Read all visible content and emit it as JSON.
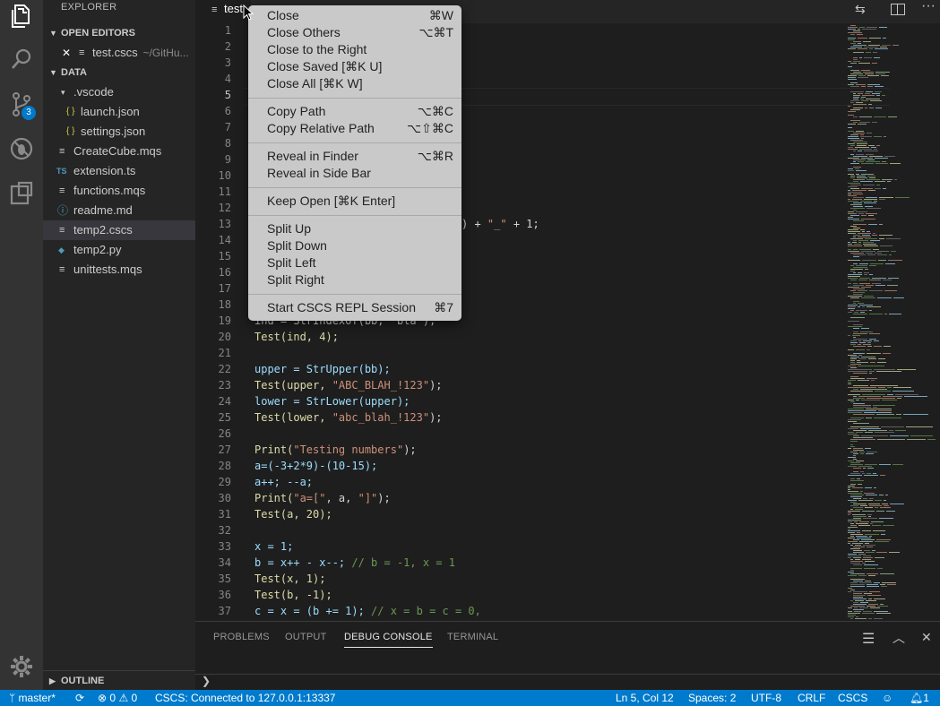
{
  "activity_bar": {
    "badge_count": "3"
  },
  "sidebar": {
    "title": "EXPLORER",
    "open_editors": {
      "header": "OPEN EDITORS",
      "item_name": "test.cscs",
      "item_path": "~/GitHu..."
    },
    "folder": {
      "header": "DATA",
      "items": [
        {
          "name": ".vscode",
          "icon": "▾",
          "level": 1
        },
        {
          "name": "launch.json",
          "icon": "{ }",
          "level": 2
        },
        {
          "name": "settings.json",
          "icon": "{ }",
          "level": 2
        },
        {
          "name": "CreateCube.mqs",
          "icon": "≡",
          "level": 1
        },
        {
          "name": "extension.ts",
          "icon": "TS",
          "level": 1
        },
        {
          "name": "functions.mqs",
          "icon": "≡",
          "level": 1
        },
        {
          "name": "readme.md",
          "icon": "ⓘ",
          "level": 1
        },
        {
          "name": "temp2.cscs",
          "icon": "≡",
          "level": 1
        },
        {
          "name": "temp2.py",
          "icon": "◆",
          "level": 1
        },
        {
          "name": "unittests.mqs",
          "icon": "≡",
          "level": 1
        }
      ]
    },
    "outline": "OUTLINE"
  },
  "editor": {
    "tab_label": "test",
    "line_numbers": [
      "1",
      "2",
      "3",
      "4",
      "5",
      "6",
      "7",
      "8",
      "9",
      "10",
      "11",
      "12",
      "13",
      "14",
      "15",
      "16",
      "17",
      "18",
      "19",
      "20",
      "21",
      "22",
      "23",
      "24",
      "25",
      "26",
      "27",
      "28",
      "29",
      "30",
      "31",
      "32",
      "33",
      "34",
      "35",
      "36",
      "37"
    ],
    "current_line": "5",
    "visible_code": {
      "l13_tail_paren": ") + ",
      "l13_str": "\"_\"",
      "l13_end": " + 1;",
      "l19": "ind = StrIndexOf(bb, \"bla\");",
      "l20": "Test(ind, 4);",
      "l22": "upper = StrUpper(bb);",
      "l23a": "Test(upper, ",
      "l23s": "\"ABC_BLAH_!123\"",
      "l23b": ");",
      "l24": "lower = StrLower(upper);",
      "l25a": "Test(lower, ",
      "l25s": "\"abc_blah_!123\"",
      "l25b": ");",
      "l27a": "Print(",
      "l27s": "\"Testing numbers\"",
      "l27b": ");",
      "l28": "a=(-3+2*9)-(10-15);",
      "l29": "a++; --a;",
      "l30a": "Print(",
      "l30s1": "\"a=[\"",
      "l30m": ", a, ",
      "l30s2": "\"]\"",
      "l30b": ");",
      "l31": "Test(a, 20);",
      "l33": "x = 1;",
      "l34a": "b = x++ - x--; ",
      "l34c": "// b = -1, x = 1",
      "l35": "Test(x, 1);",
      "l36": "Test(b, -1);",
      "l37a": "c = x = (b += 1); ",
      "l37c": "// x = b = c = 0,"
    }
  },
  "context_menu": {
    "items": [
      {
        "label": "Close",
        "shortcut": "⌘W"
      },
      {
        "label": "Close Others",
        "shortcut": "⌥⌘T"
      },
      {
        "label": "Close to the Right",
        "shortcut": ""
      },
      {
        "label": "Close Saved [⌘K U]",
        "shortcut": ""
      },
      {
        "label": "Close All [⌘K W]",
        "shortcut": ""
      },
      {
        "label": "Copy Path",
        "shortcut": "⌥⌘C"
      },
      {
        "label": "Copy Relative Path",
        "shortcut": "⌥⇧⌘C"
      },
      {
        "label": "Reveal in Finder",
        "shortcut": "⌥⌘R"
      },
      {
        "label": "Reveal in Side Bar",
        "shortcut": ""
      },
      {
        "label": "Keep Open [⌘K Enter]",
        "shortcut": ""
      },
      {
        "label": "Split Up",
        "shortcut": ""
      },
      {
        "label": "Split Down",
        "shortcut": ""
      },
      {
        "label": "Split Left",
        "shortcut": ""
      },
      {
        "label": "Split Right",
        "shortcut": ""
      },
      {
        "label": "Start CSCS REPL Session",
        "shortcut": "⌘7"
      }
    ]
  },
  "panel": {
    "tabs": [
      "PROBLEMS",
      "OUTPUT",
      "DEBUG CONSOLE",
      "TERMINAL"
    ],
    "active_tab": "DEBUG CONSOLE",
    "prompt": "❯"
  },
  "status_bar": {
    "branch": "master*",
    "errors": "0",
    "warnings": "0",
    "connection": "CSCS: Connected to 127.0.0.1:13337",
    "position": "Ln 5, Col 12",
    "spaces": "Spaces: 2",
    "encoding": "UTF-8",
    "eol": "CRLF",
    "language": "CSCS",
    "notifications": "1"
  },
  "colors": {
    "accent": "#007acc",
    "activity_bar": "#333333",
    "sidebar": "#252526",
    "editor": "#1e1e1e",
    "menu": "#c9c9c9"
  }
}
